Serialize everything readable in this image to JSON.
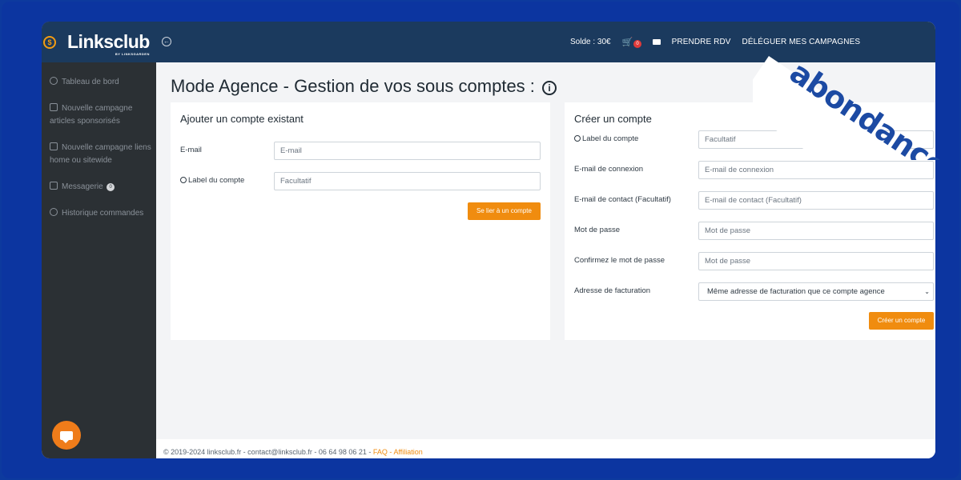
{
  "brand": {
    "name": "Linksclub",
    "sub": "BY LINKSGARDEN"
  },
  "nav": [
    {
      "label": "Tableau de bord"
    },
    {
      "label": "Nouvelle campagne articles sponsorisés"
    },
    {
      "label": "Nouvelle campagne liens home ou sitewide"
    },
    {
      "label": "Messagerie",
      "badge": "0"
    },
    {
      "label": "Historique commandes"
    }
  ],
  "topbar": {
    "balance": "Solde : 30€",
    "cart_count": "0",
    "link_rdv": "PRENDRE RDV",
    "link_delegate": "DÉLÉGUER MES CAMPAGNES"
  },
  "page_title": "Mode Agence - Gestion de vos sous comptes :",
  "left_card": {
    "title": "Ajouter un compte existant",
    "email_label": "E-mail",
    "email_placeholder": "E-mail",
    "label_label": "Label du compte",
    "label_placeholder": "Facultatif",
    "button": "Se lier à un compte"
  },
  "right_card": {
    "title": "Créer un compte",
    "fields": [
      {
        "label": "Label du compte",
        "placeholder": "Facultatif"
      },
      {
        "label": "E-mail de connexion",
        "placeholder": "E-mail de connexion"
      },
      {
        "label": "E-mail de contact (Facultatif)",
        "placeholder": "E-mail de contact (Facultatif)"
      },
      {
        "label": "Mot de passe",
        "placeholder": "Mot de passe"
      },
      {
        "label": "Confirmez le mot de passe",
        "placeholder": "Mot de passe"
      }
    ],
    "billing_label": "Adresse de facturation",
    "billing_value": "Même adresse de facturation que ce compte agence",
    "button": "Créer un compte"
  },
  "footer": {
    "text": "© 2019-2024 linksclub.fr - contact@linksclub.fr - 06 64 98 06 21 - ",
    "faq": "FAQ",
    "sep": " - ",
    "affiliation": "Affiliation"
  },
  "watermark": "abondance",
  "colors": {
    "accent": "#f08c0f",
    "sidebar": "#2b3034",
    "topbar": "#1b3a5e",
    "frame": "#0c35a0"
  }
}
